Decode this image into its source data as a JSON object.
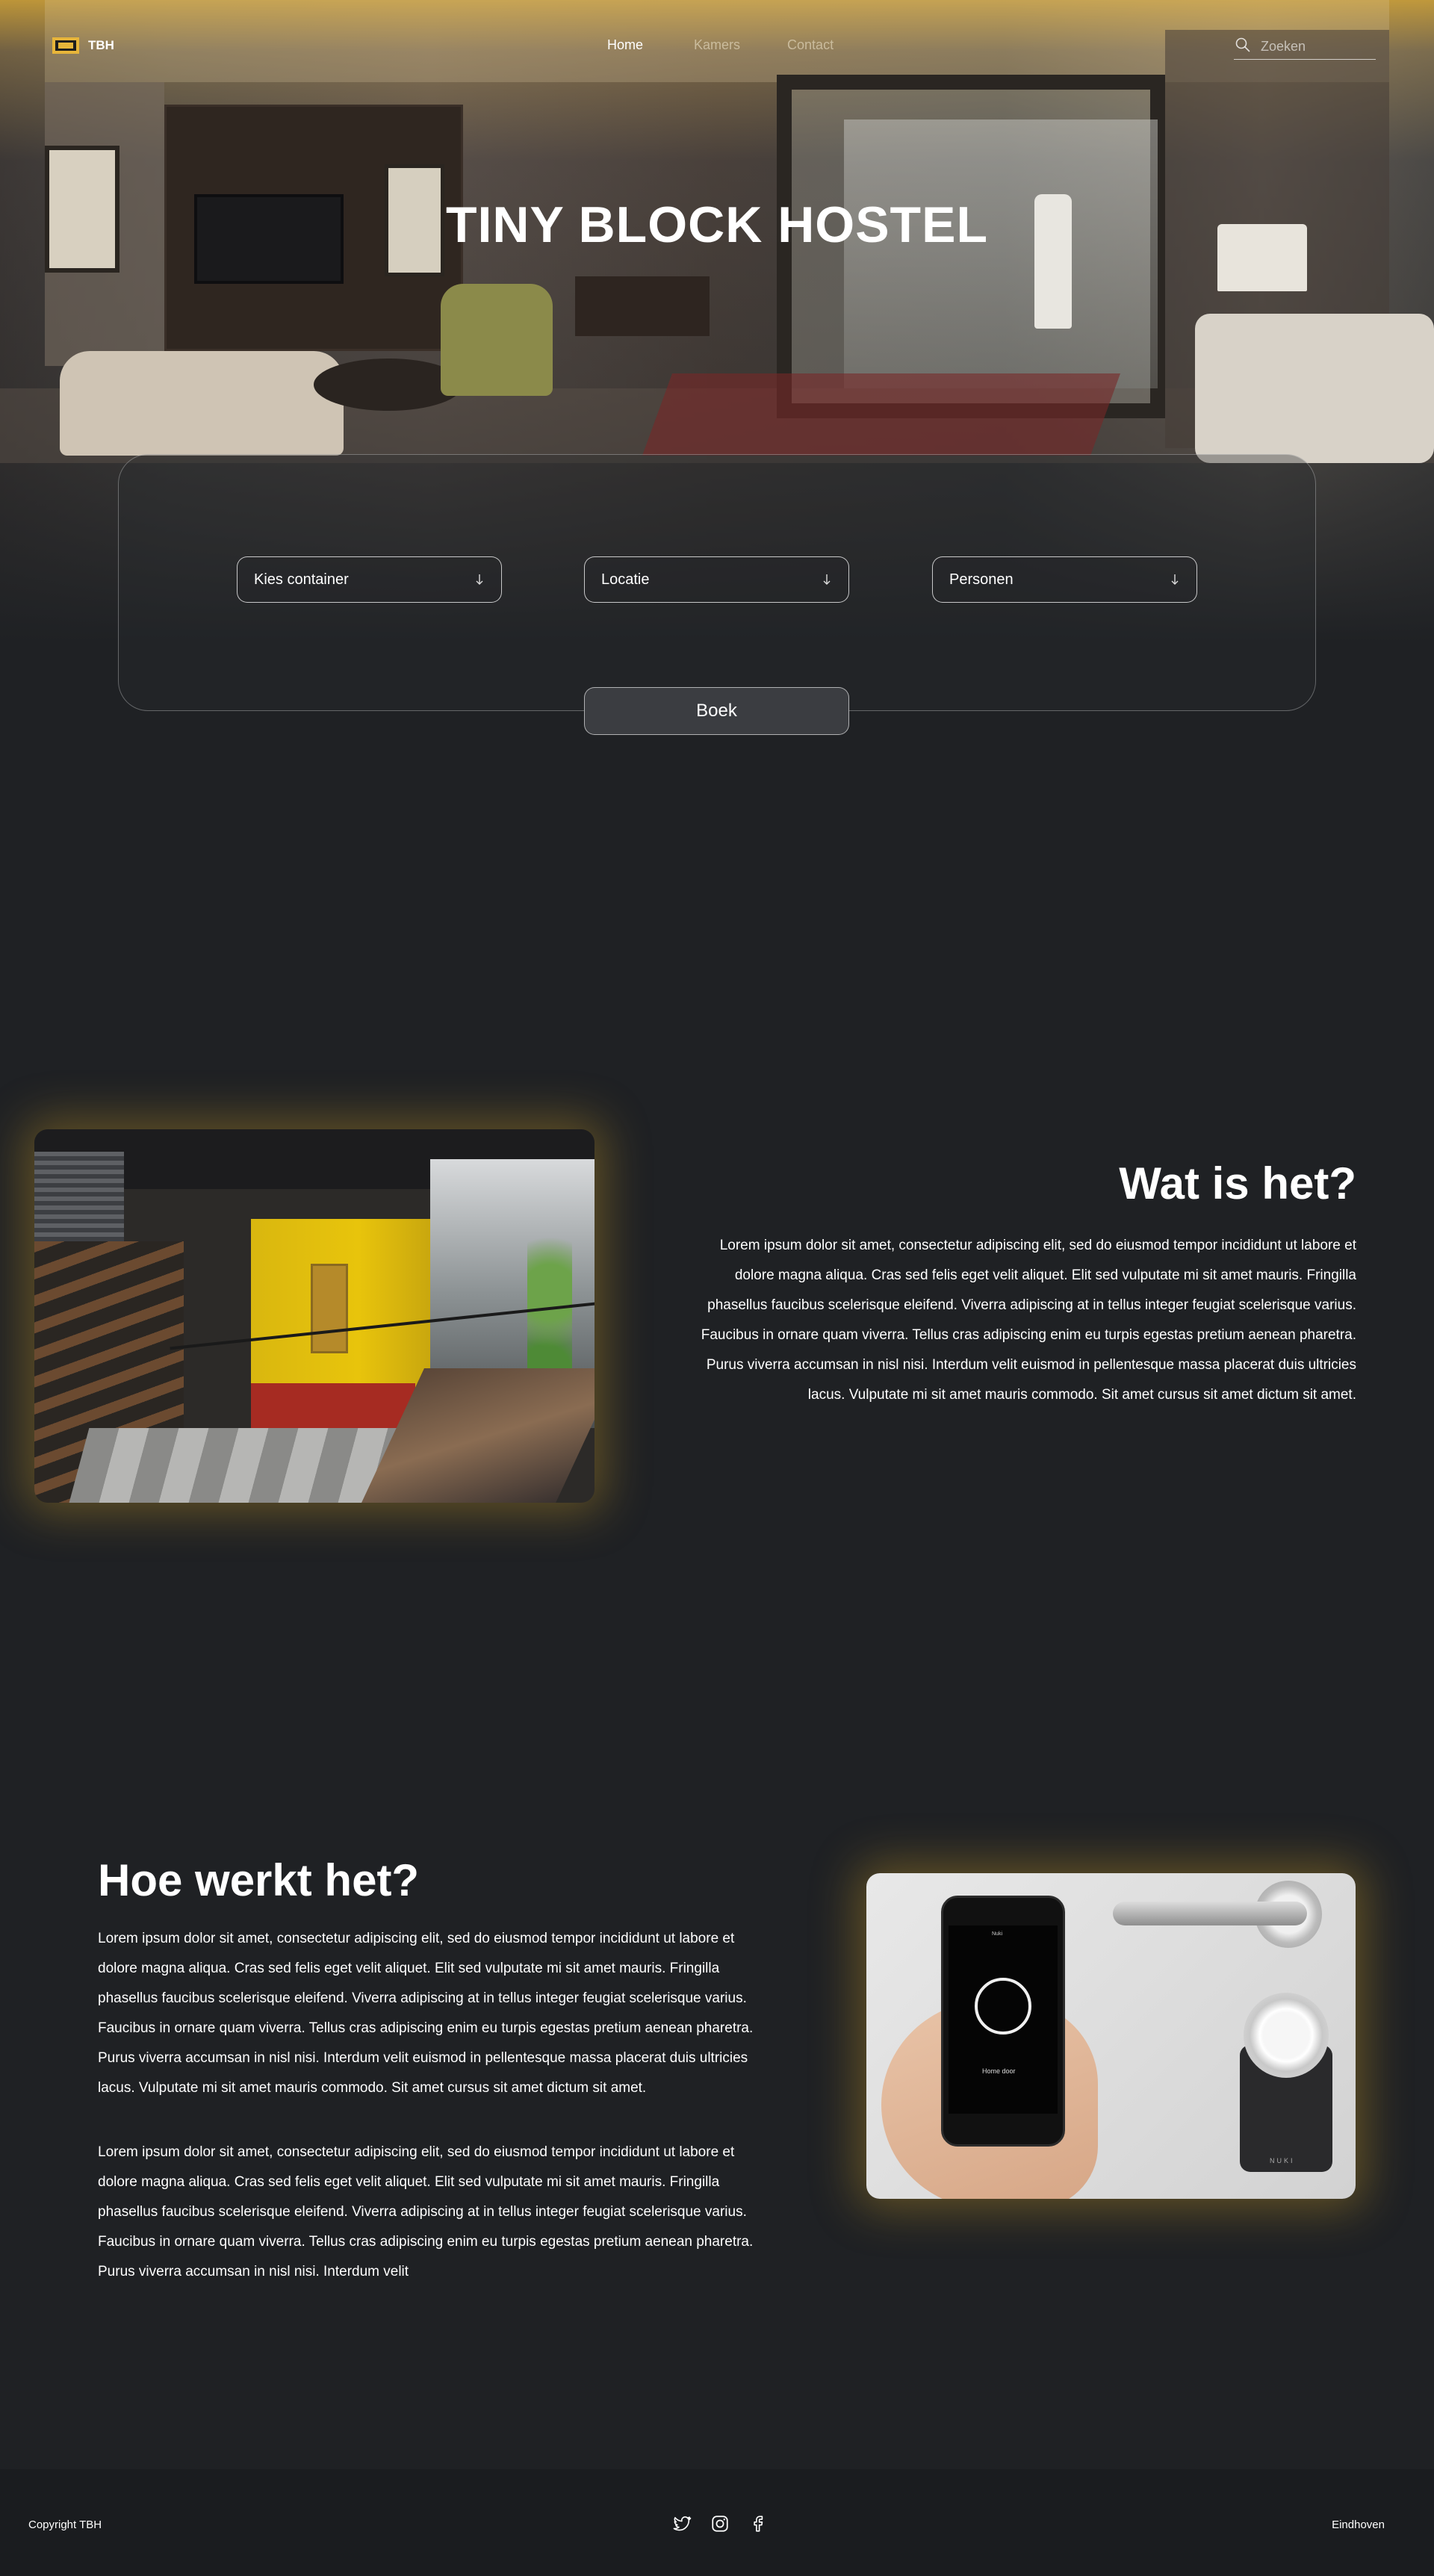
{
  "nav": {
    "logo_text": "TBH",
    "links": [
      {
        "label": "Home"
      },
      {
        "label": "Kamers"
      },
      {
        "label": "Contact"
      }
    ],
    "search_placeholder": "Zoeken"
  },
  "hero": {
    "title": "TINY BLOCK HOSTEL"
  },
  "booking": {
    "selects": [
      {
        "label": "Kies container"
      },
      {
        "label": "Locatie"
      },
      {
        "label": "Personen"
      }
    ],
    "book_label": "Boek"
  },
  "section_what": {
    "title": "Wat is het?",
    "body": "Lorem ipsum dolor sit amet, consectetur adipiscing elit, sed do eiusmod tempor incididunt ut labore et dolore magna aliqua. Cras sed felis eget velit aliquet. Elit sed vulputate mi sit amet mauris. Fringilla phasellus faucibus scelerisque eleifend. Viverra adipiscing at in tellus integer feugiat scelerisque varius. Faucibus in ornare quam viverra. Tellus cras adipiscing enim eu turpis egestas pretium aenean pharetra. Purus viverra accumsan in nisl nisi. Interdum velit euismod in pellentesque massa placerat duis ultricies lacus. Vulputate mi sit amet mauris commodo. Sit amet cursus sit amet dictum sit amet."
  },
  "section_how": {
    "title": "Hoe werkt het?",
    "paragraphs": [
      "Lorem ipsum dolor sit amet, consectetur adipiscing elit, sed do eiusmod tempor incididunt ut labore et dolore magna aliqua. Cras sed felis eget velit aliquet. Elit sed vulputate mi sit amet mauris. Fringilla phasellus faucibus scelerisque eleifend. Viverra adipiscing at in tellus integer feugiat scelerisque varius. Faucibus in ornare quam viverra. Tellus cras adipiscing enim eu turpis egestas pretium aenean pharetra. Purus viverra accumsan in nisl nisi. Interdum velit euismod in pellentesque massa placerat duis ultricies lacus. Vulputate mi sit amet mauris commodo. Sit amet cursus sit amet dictum sit amet.",
      "Lorem ipsum dolor sit amet, consectetur adipiscing elit, sed do eiusmod tempor incididunt ut labore et dolore magna aliqua. Cras sed felis eget velit aliquet. Elit sed vulputate mi sit amet mauris. Fringilla phasellus faucibus scelerisque eleifend. Viverra adipiscing at in tellus integer feugiat scelerisque varius. Faucibus in ornare quam viverra. Tellus cras adipiscing enim eu turpis egestas pretium aenean pharetra. Purus viverra accumsan in nisl nisi. Interdum velit"
    ],
    "image_phone_label": "Home door",
    "image_phone_top": "Nuki",
    "image_lock_brand": "NUKI"
  },
  "footer": {
    "copyright": "Copyright TBH",
    "socials": [
      "twitter-icon",
      "instagram-icon",
      "facebook-icon"
    ],
    "location": "Eindhoven"
  },
  "colors": {
    "background": "#1f2124",
    "accent": "#e7b53a",
    "footer": "#1a1c1f"
  }
}
